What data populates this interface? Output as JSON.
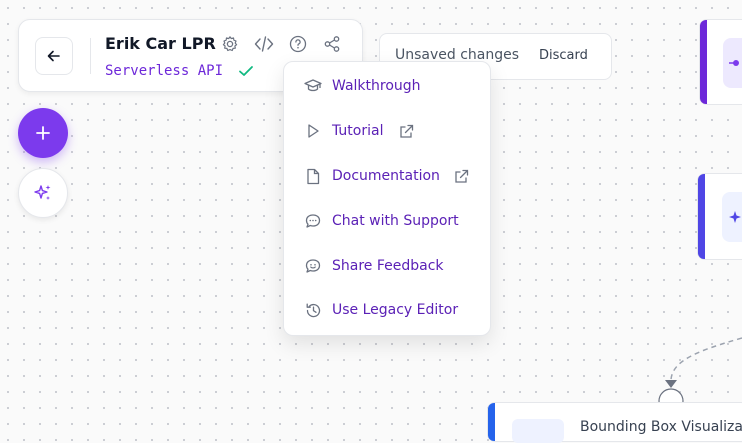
{
  "header": {
    "title": "Erik Car LPR",
    "workflow_type": "Serverless API",
    "icons": [
      "settings-icon",
      "code-icon",
      "help-icon",
      "share-icon"
    ]
  },
  "unsaved": {
    "message": "Unsaved changes",
    "discard_label": "Discard"
  },
  "help_menu": {
    "items": [
      {
        "label": "Walkthrough",
        "icon": "graduation-cap-icon",
        "external": false
      },
      {
        "label": "Tutorial",
        "icon": "play-icon",
        "external": true
      },
      {
        "label": "Documentation",
        "icon": "file-icon",
        "external": true
      },
      {
        "label": "Chat with Support",
        "icon": "chat-icon",
        "external": false
      },
      {
        "label": "Share Feedback",
        "icon": "feedback-icon",
        "external": false
      },
      {
        "label": "Use Legacy Editor",
        "icon": "history-icon",
        "external": false
      }
    ]
  },
  "canvas": {
    "bottom_node_label": "Bounding Box Visualizat"
  },
  "colors": {
    "accent": "#7c3aed",
    "menu_text": "#5b21b6",
    "success": "#10b981",
    "node_blue": "#2563eb",
    "node_purple": "#6d28d9"
  }
}
